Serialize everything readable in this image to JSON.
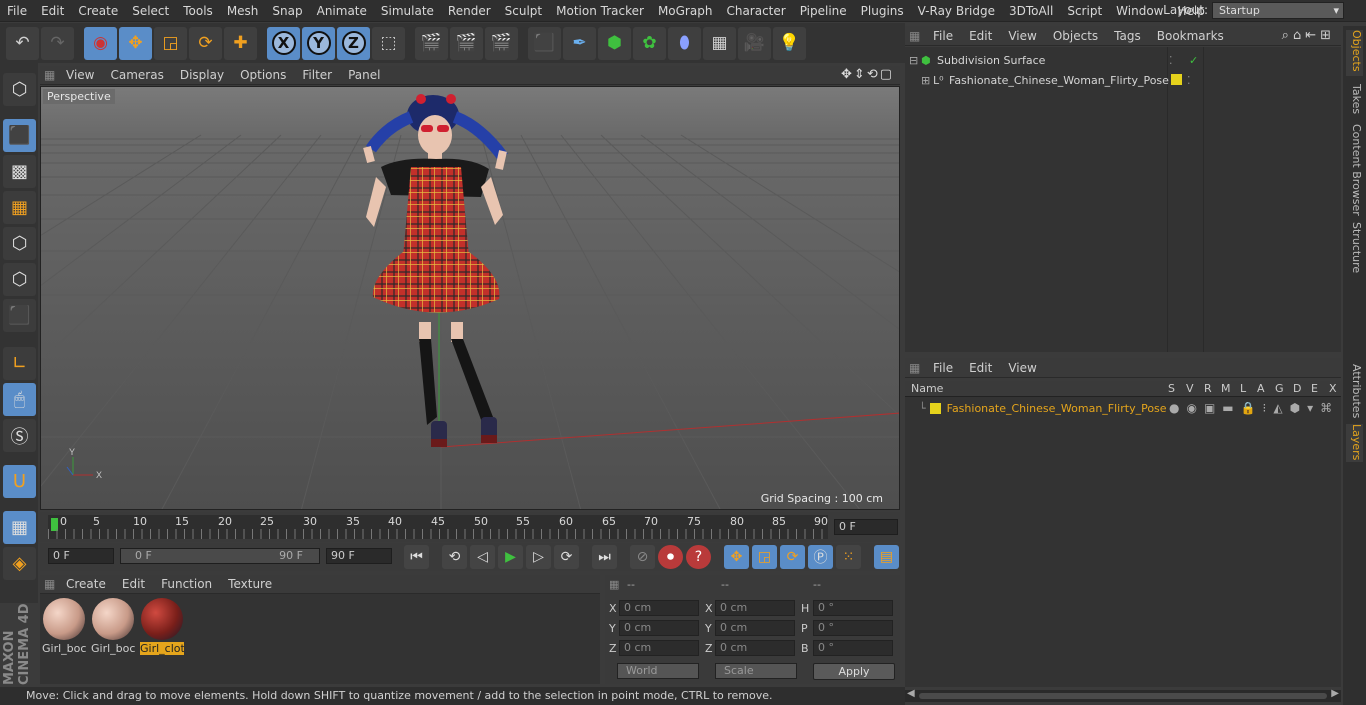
{
  "menu": [
    "File",
    "Edit",
    "Create",
    "Select",
    "Tools",
    "Mesh",
    "Snap",
    "Animate",
    "Simulate",
    "Render",
    "Sculpt",
    "Motion Tracker",
    "MoGraph",
    "Character",
    "Pipeline",
    "Plugins",
    "V-Ray Bridge",
    "3DToAll",
    "Script",
    "Window",
    "Help"
  ],
  "layout": {
    "label": "Layout:",
    "value": "Startup"
  },
  "viewport": {
    "menu": [
      "View",
      "Cameras",
      "Display",
      "Options",
      "Filter",
      "Panel"
    ],
    "camera_label": "Perspective",
    "grid_spacing": "Grid Spacing : 100 cm",
    "axis_y": "Y",
    "axis_x": "X"
  },
  "timeline": {
    "ticks": [
      "0",
      "5",
      "10",
      "15",
      "20",
      "25",
      "30",
      "35",
      "40",
      "45",
      "50",
      "55",
      "60",
      "65",
      "70",
      "75",
      "80",
      "85",
      "90"
    ],
    "current_frame": "0 F"
  },
  "transport": {
    "start_field": "0 F",
    "range_start": "0 F",
    "range_end": "90 F",
    "end_field": "90 F"
  },
  "materials": {
    "menu": [
      "Create",
      "Edit",
      "Function",
      "Texture"
    ],
    "items": [
      {
        "label": "Girl_boc",
        "selected": false
      },
      {
        "label": "Girl_boc",
        "selected": false
      },
      {
        "label": "Girl_clot",
        "selected": true
      }
    ]
  },
  "coordinates": {
    "header": [
      "--",
      "--",
      "--"
    ],
    "rows": [
      {
        "a": "X",
        "av": "0 cm",
        "b": "X",
        "bv": "0 cm",
        "c": "H",
        "cv": "0 °"
      },
      {
        "a": "Y",
        "av": "0 cm",
        "b": "Y",
        "bv": "0 cm",
        "c": "P",
        "cv": "0 °"
      },
      {
        "a": "Z",
        "av": "0 cm",
        "b": "Z",
        "bv": "0 cm",
        "c": "B",
        "cv": "0 °"
      }
    ],
    "space": "World",
    "mode": "Scale",
    "apply": "Apply"
  },
  "status": "Move: Click and drag to move elements. Hold down SHIFT to quantize movement / add to the selection in point mode, CTRL to remove.",
  "objects": {
    "menu": [
      "File",
      "Edit",
      "View",
      "Objects",
      "Tags",
      "Bookmarks"
    ],
    "items": [
      {
        "name": "Subdivision Surface"
      },
      {
        "name": "Fashionate_Chinese_Woman_Flirty_Pose"
      }
    ]
  },
  "layers": {
    "menu": [
      "File",
      "Edit",
      "View"
    ],
    "columns": {
      "name": "Name",
      "flags": [
        "S",
        "V",
        "R",
        "M",
        "L",
        "A",
        "G",
        "D",
        "E",
        "X"
      ]
    },
    "items": [
      {
        "name": "Fashionate_Chinese_Woman_Flirty_Pose",
        "color": "#e5d21c"
      }
    ]
  },
  "right_tabs": [
    "Objects",
    "Takes",
    "Content Browser",
    "Structure",
    "Attributes",
    "Layers"
  ],
  "brand": "MAXON CINEMA 4D",
  "colors": {
    "accent": "#e5a51c",
    "tool_blue": "#5a8dc8",
    "layer_yellow": "#e5d21c"
  }
}
